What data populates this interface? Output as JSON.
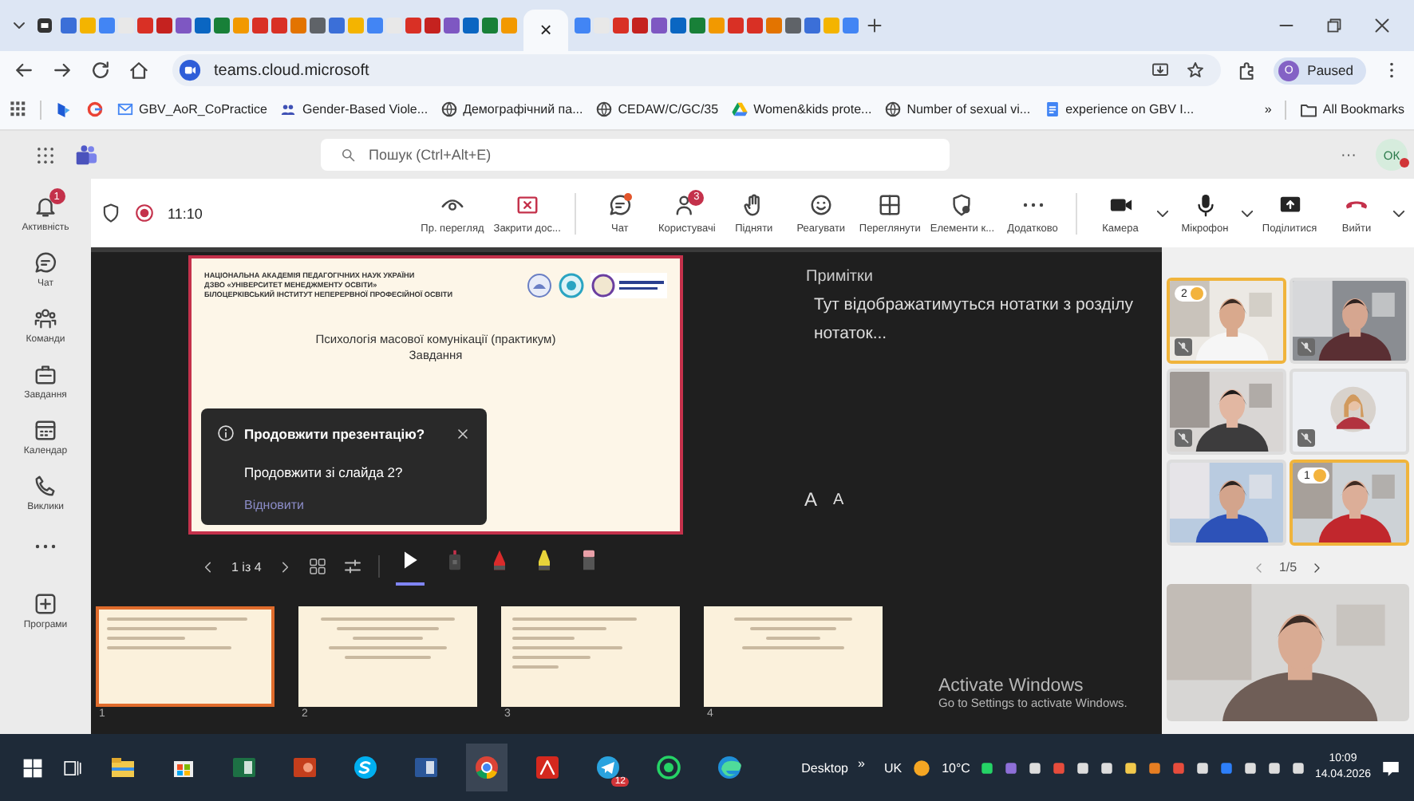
{
  "browser": {
    "tab_close": "×",
    "address": "teams.cloud.microsoft",
    "profile": {
      "initial": "O",
      "label": "Paused"
    },
    "bookmarks": [
      {
        "label": "GBV_AoR_CoPractice",
        "kind": "mail"
      },
      {
        "label": "Gender-Based Viole...",
        "kind": "people"
      },
      {
        "label": "Демографічний па...",
        "kind": "globe"
      },
      {
        "label": "CEDAW/C/GC/35",
        "kind": "globe"
      },
      {
        "label": "Women&kids prote...",
        "kind": "drive"
      },
      {
        "label": "Number of sexual vi...",
        "kind": "globe"
      },
      {
        "label": "experience on GBV I...",
        "kind": "doc"
      }
    ],
    "bookmarks_more": "»",
    "all_bookmarks": "All Bookmarks"
  },
  "teams": {
    "search": {
      "placeholder": "Пошук (Ctrl+Alt+E)"
    },
    "more": "···",
    "avatar": "ОК",
    "rail": [
      {
        "label": "Активність",
        "kind": "bell",
        "badge": "1"
      },
      {
        "label": "Чат",
        "kind": "chat"
      },
      {
        "label": "Команди",
        "kind": "teams"
      },
      {
        "label": "Завдання",
        "kind": "tasks"
      },
      {
        "label": "Календар",
        "kind": "calendar"
      },
      {
        "label": "Виклики",
        "kind": "calls"
      },
      {
        "kind": "more"
      },
      {
        "label": "Програми",
        "kind": "apps"
      }
    ]
  },
  "meeting": {
    "time": "11:10",
    "toolbar": [
      {
        "label": "Пр. перегляд",
        "kind": "view"
      },
      {
        "label": "Закрити дос...",
        "kind": "stop"
      },
      {
        "label": "Чат",
        "kind": "chat",
        "unread": true
      },
      {
        "label": "Користувачі",
        "kind": "people",
        "badge": "3"
      },
      {
        "label": "Підняти",
        "kind": "raise"
      },
      {
        "label": "Реагувати",
        "kind": "react"
      },
      {
        "label": "Переглянути",
        "kind": "layout"
      },
      {
        "label": "Елементи к...",
        "kind": "apps"
      },
      {
        "label": "Додатково",
        "kind": "more"
      },
      {
        "label": "Камера",
        "kind": "camera",
        "dropdown": true
      },
      {
        "label": "Мікрофон",
        "kind": "mic",
        "dropdown": true
      },
      {
        "label": "Поділитися",
        "kind": "share"
      },
      {
        "label": "Вийти",
        "kind": "leave",
        "dropdown": true
      }
    ],
    "slide": {
      "header": [
        "НАЦІОНАЛЬНА АКАДЕМІЯ ПЕДАГОГІЧНИХ НАУК УКРАЇНИ",
        "ДЗВО «УНІВЕРСИТЕТ МЕНЕДЖМЕНТУ ОСВІТИ»",
        "БІЛОЦЕРКІВСЬКИЙ ІНСТИТУТ НЕПЕРЕРВНОЇ ПРОФЕСІЙНОЇ ОСВІТИ"
      ],
      "title": "Психологія масової комунікації (практикум)",
      "subtitle": "Завдання"
    },
    "dialog": {
      "title": "Продовжити презентацію?",
      "body": "Продовжити зі слайда 2?",
      "action": "Відновити"
    },
    "page": "1 із 4",
    "tools": [
      {
        "kind": "pointer",
        "selected": true
      },
      {
        "kind": "laser",
        "selected": false
      },
      {
        "kind": "pen",
        "selected": false
      },
      {
        "kind": "highlighter",
        "selected": false
      },
      {
        "kind": "eraser",
        "selected": false
      }
    ],
    "notes": {
      "title": "Примітки",
      "text": "Тут відображатимуться нотатки з розділу нотаток...",
      "font_buttons": [
        "A",
        "A"
      ]
    },
    "thumbnails": [
      {
        "number": "1",
        "selected": true
      },
      {
        "number": "2",
        "selected": false
      },
      {
        "number": "3",
        "selected": false
      },
      {
        "number": "4",
        "selected": false
      }
    ],
    "videos": [
      {
        "hand": "2",
        "highlighted": true,
        "muted": true
      },
      {
        "highlighted": false,
        "muted": true
      },
      {
        "highlighted": false,
        "muted": true
      },
      {
        "highlighted": false,
        "muted": true,
        "kind": "avatar"
      },
      {
        "highlighted": false,
        "muted": false
      },
      {
        "hand": "1",
        "highlighted": true,
        "muted": false
      }
    ],
    "pager": "1/5"
  },
  "watermark_os": {
    "title": "Activate Windows",
    "text": "Go to Settings to activate Windows."
  },
  "taskbar": {
    "desktop": "Desktop",
    "more": "»",
    "language": "UK",
    "temperature": "10°C",
    "time": "10:09",
    "date": "14.04.2026",
    "telegram_badge": "12"
  }
}
